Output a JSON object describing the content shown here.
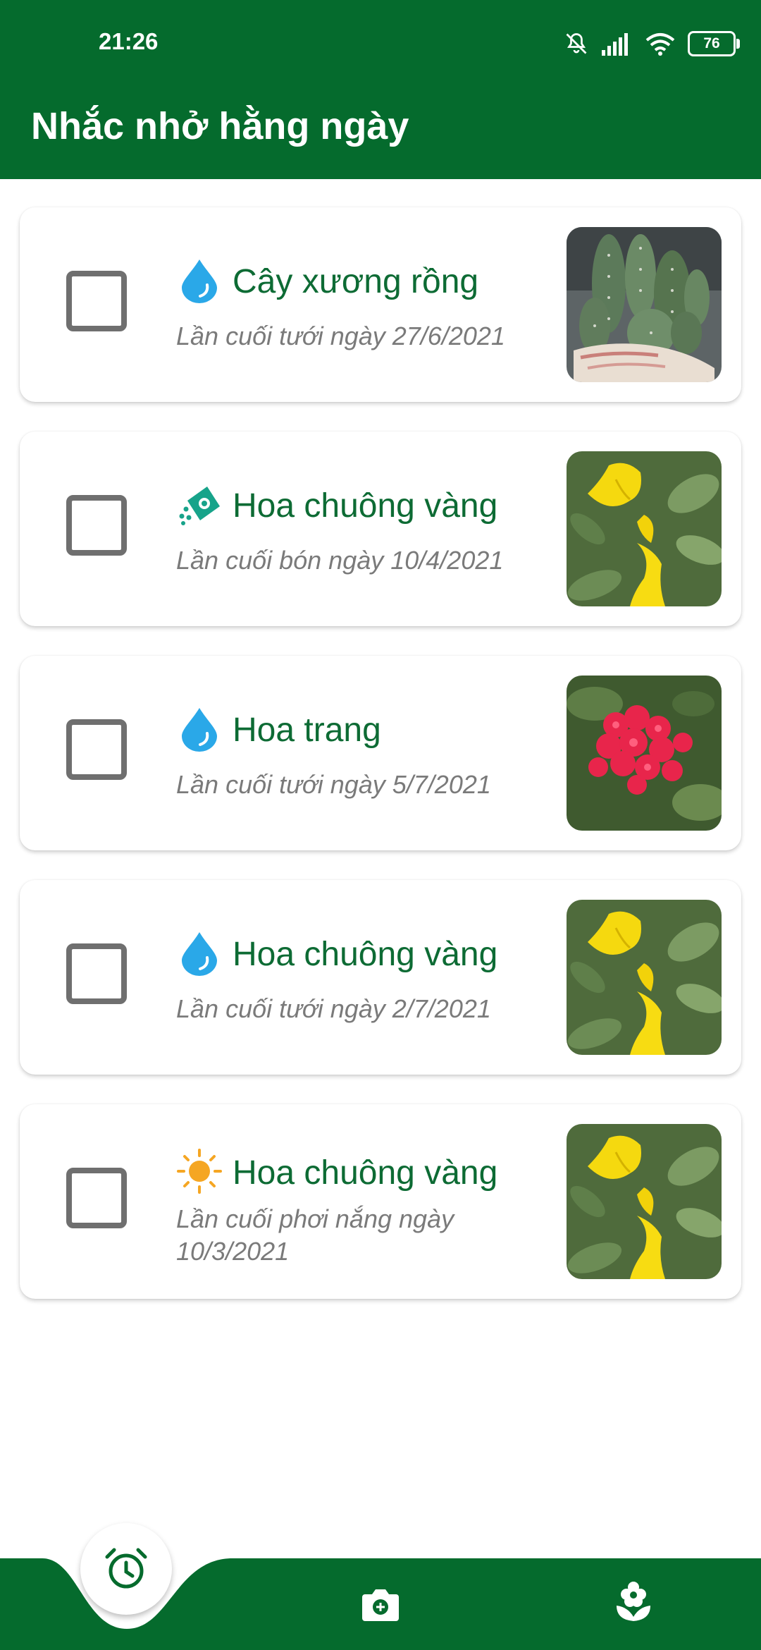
{
  "status_bar": {
    "time": "21:26",
    "battery": "76"
  },
  "app_bar": {
    "title": "Nhắc nhở hằng ngày"
  },
  "reminders": [
    {
      "task": "water",
      "task_icon": "water-drop-icon",
      "plant_name": "Cây xương rồng",
      "last_care": "Lần cuối tưới ngày 27/6/2021",
      "photo": "cactus"
    },
    {
      "task": "fertilize",
      "task_icon": "fertilizer-icon",
      "plant_name": "Hoa chuông vàng",
      "last_care": "Lần cuối bón ngày 10/4/2021",
      "photo": "yellow-bell-flower"
    },
    {
      "task": "water",
      "task_icon": "water-drop-icon",
      "plant_name": "Hoa trang",
      "last_care": "Lần cuối tưới ngày 5/7/2021",
      "photo": "red-ixora-flower"
    },
    {
      "task": "water",
      "task_icon": "water-drop-icon",
      "plant_name": "Hoa chuông vàng",
      "last_care": "Lần cuối tưới ngày 2/7/2021",
      "photo": "yellow-bell-flower"
    },
    {
      "task": "sun",
      "task_icon": "sun-icon",
      "plant_name": "Hoa chuông vàng",
      "last_care": "Lần cuối phơi nắng ngày 10/3/2021",
      "photo": "yellow-bell-flower"
    }
  ],
  "bottom_nav": {
    "items": [
      {
        "name": "reminders",
        "icon": "alarm-clock-icon",
        "active": true
      },
      {
        "name": "camera",
        "icon": "camera-icon",
        "active": false
      },
      {
        "name": "plants",
        "icon": "plant-flower-icon",
        "active": false
      }
    ]
  },
  "colors": {
    "primary": "#056b2d",
    "plant_name": "#0d6b34",
    "water": "#2aa8e8",
    "sun": "#f5a623",
    "fertilizer": "#17a38a"
  }
}
